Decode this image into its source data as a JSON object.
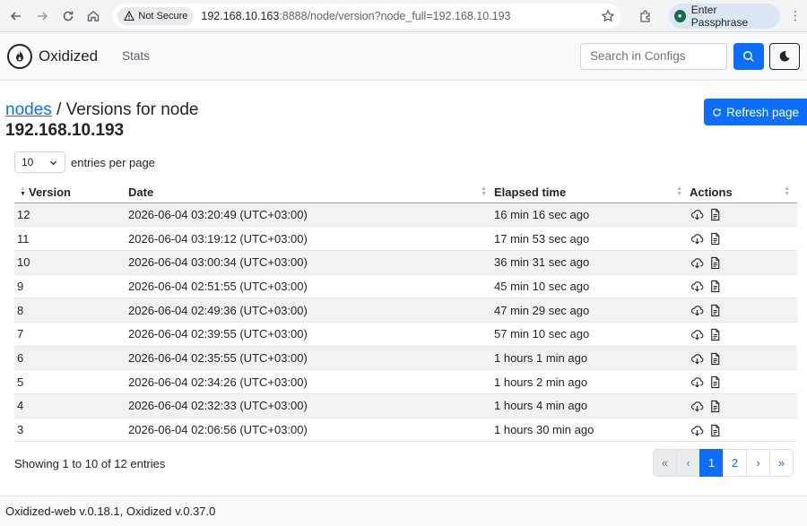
{
  "browser": {
    "security_label": "Not Secure",
    "url_host": "192.168.10.163",
    "url_path": ":8888/node/version?node_full=192.168.10.193",
    "extension_chip": "Enter Passphrase"
  },
  "navbar": {
    "brand": "Oxidized",
    "stats_link": "Stats",
    "search_placeholder": "Search in Configs"
  },
  "header": {
    "breadcrumb_link": "nodes",
    "title_rest": "/ Versions for node",
    "node_name": "192.168.10.193",
    "refresh_label": "Refresh page"
  },
  "length": {
    "value": "10",
    "label": "entries per page"
  },
  "table": {
    "columns": [
      "Version",
      "Date",
      "Elapsed time",
      "Actions"
    ],
    "rows": [
      {
        "version": "12",
        "date": "2026-06-04 03:20:49 (UTC+03:00)",
        "elapsed": "16 min 16 sec ago"
      },
      {
        "version": "11",
        "date": "2026-06-04 03:19:12 (UTC+03:00)",
        "elapsed": "17 min 53 sec ago"
      },
      {
        "version": "10",
        "date": "2026-06-04 03:00:34 (UTC+03:00)",
        "elapsed": "36 min 31 sec ago"
      },
      {
        "version": "9",
        "date": "2026-06-04 02:51:55 (UTC+03:00)",
        "elapsed": "45 min 10 sec ago"
      },
      {
        "version": "8",
        "date": "2026-06-04 02:49:36 (UTC+03:00)",
        "elapsed": "47 min 29 sec ago"
      },
      {
        "version": "7",
        "date": "2026-06-04 02:39:55 (UTC+03:00)",
        "elapsed": "57 min 10 sec ago"
      },
      {
        "version": "6",
        "date": "2026-06-04 02:35:55 (UTC+03:00)",
        "elapsed": "1 hours 1 min ago"
      },
      {
        "version": "5",
        "date": "2026-06-04 02:34:26 (UTC+03:00)",
        "elapsed": "1 hours 2 min ago"
      },
      {
        "version": "4",
        "date": "2026-06-04 02:32:33 (UTC+03:00)",
        "elapsed": "1 hours 4 min ago"
      },
      {
        "version": "3",
        "date": "2026-06-04 02:06:56 (UTC+03:00)",
        "elapsed": "1 hours 30 min ago"
      }
    ],
    "action_icons": [
      "download-cloud-icon",
      "file-text-icon"
    ]
  },
  "info": "Showing 1 to 10 of 12 entries",
  "pagination": {
    "first": "«",
    "prev": "‹",
    "pages": [
      "1",
      "2"
    ],
    "next": "›",
    "last": "»"
  },
  "footer": "Oxidized-web v.0.18.1, Oxidized v.0.37.0",
  "colors": {
    "primary": "#0d6efd",
    "stripe": "#f2f2f2"
  }
}
